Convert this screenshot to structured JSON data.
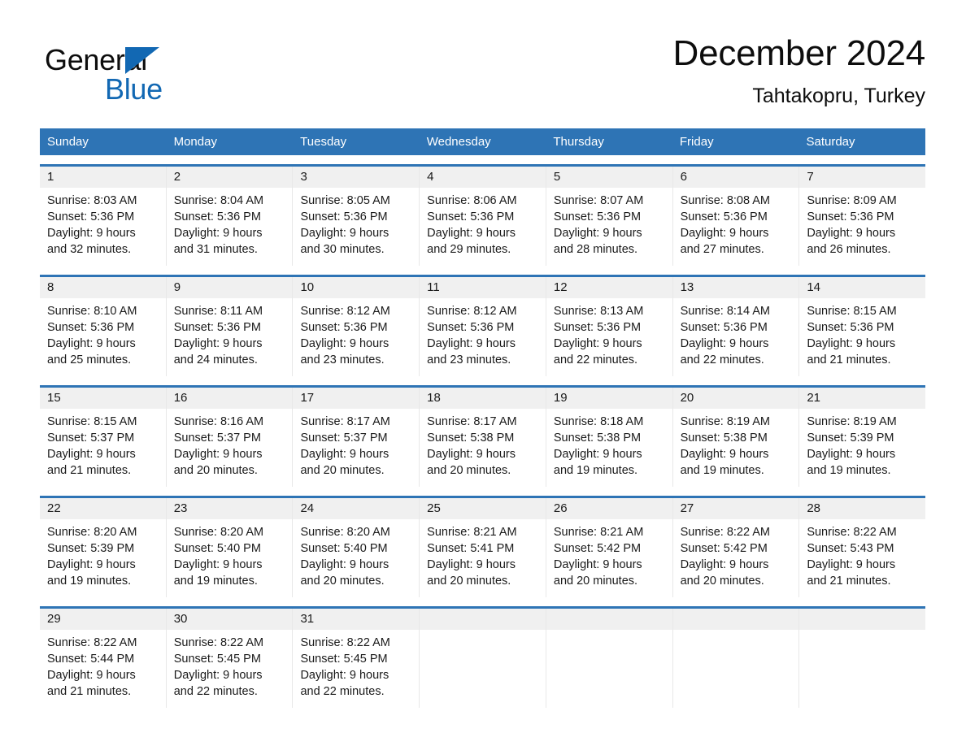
{
  "brand": {
    "name_part1": "General",
    "name_part2": "Blue",
    "accent_color": "#1268b3"
  },
  "header": {
    "title": "December 2024",
    "subtitle": "Tahtakopru, Turkey",
    "header_bg_color": "#2e74b5",
    "day_band_color": "#f0f0f0"
  },
  "weekdays": [
    "Sunday",
    "Monday",
    "Tuesday",
    "Wednesday",
    "Thursday",
    "Friday",
    "Saturday"
  ],
  "weeks": [
    [
      {
        "day": "1",
        "sunrise": "Sunrise: 8:03 AM",
        "sunset": "Sunset: 5:36 PM",
        "daylight_line1": "Daylight: 9 hours",
        "daylight_line2": "and 32 minutes."
      },
      {
        "day": "2",
        "sunrise": "Sunrise: 8:04 AM",
        "sunset": "Sunset: 5:36 PM",
        "daylight_line1": "Daylight: 9 hours",
        "daylight_line2": "and 31 minutes."
      },
      {
        "day": "3",
        "sunrise": "Sunrise: 8:05 AM",
        "sunset": "Sunset: 5:36 PM",
        "daylight_line1": "Daylight: 9 hours",
        "daylight_line2": "and 30 minutes."
      },
      {
        "day": "4",
        "sunrise": "Sunrise: 8:06 AM",
        "sunset": "Sunset: 5:36 PM",
        "daylight_line1": "Daylight: 9 hours",
        "daylight_line2": "and 29 minutes."
      },
      {
        "day": "5",
        "sunrise": "Sunrise: 8:07 AM",
        "sunset": "Sunset: 5:36 PM",
        "daylight_line1": "Daylight: 9 hours",
        "daylight_line2": "and 28 minutes."
      },
      {
        "day": "6",
        "sunrise": "Sunrise: 8:08 AM",
        "sunset": "Sunset: 5:36 PM",
        "daylight_line1": "Daylight: 9 hours",
        "daylight_line2": "and 27 minutes."
      },
      {
        "day": "7",
        "sunrise": "Sunrise: 8:09 AM",
        "sunset": "Sunset: 5:36 PM",
        "daylight_line1": "Daylight: 9 hours",
        "daylight_line2": "and 26 minutes."
      }
    ],
    [
      {
        "day": "8",
        "sunrise": "Sunrise: 8:10 AM",
        "sunset": "Sunset: 5:36 PM",
        "daylight_line1": "Daylight: 9 hours",
        "daylight_line2": "and 25 minutes."
      },
      {
        "day": "9",
        "sunrise": "Sunrise: 8:11 AM",
        "sunset": "Sunset: 5:36 PM",
        "daylight_line1": "Daylight: 9 hours",
        "daylight_line2": "and 24 minutes."
      },
      {
        "day": "10",
        "sunrise": "Sunrise: 8:12 AM",
        "sunset": "Sunset: 5:36 PM",
        "daylight_line1": "Daylight: 9 hours",
        "daylight_line2": "and 23 minutes."
      },
      {
        "day": "11",
        "sunrise": "Sunrise: 8:12 AM",
        "sunset": "Sunset: 5:36 PM",
        "daylight_line1": "Daylight: 9 hours",
        "daylight_line2": "and 23 minutes."
      },
      {
        "day": "12",
        "sunrise": "Sunrise: 8:13 AM",
        "sunset": "Sunset: 5:36 PM",
        "daylight_line1": "Daylight: 9 hours",
        "daylight_line2": "and 22 minutes."
      },
      {
        "day": "13",
        "sunrise": "Sunrise: 8:14 AM",
        "sunset": "Sunset: 5:36 PM",
        "daylight_line1": "Daylight: 9 hours",
        "daylight_line2": "and 22 minutes."
      },
      {
        "day": "14",
        "sunrise": "Sunrise: 8:15 AM",
        "sunset": "Sunset: 5:36 PM",
        "daylight_line1": "Daylight: 9 hours",
        "daylight_line2": "and 21 minutes."
      }
    ],
    [
      {
        "day": "15",
        "sunrise": "Sunrise: 8:15 AM",
        "sunset": "Sunset: 5:37 PM",
        "daylight_line1": "Daylight: 9 hours",
        "daylight_line2": "and 21 minutes."
      },
      {
        "day": "16",
        "sunrise": "Sunrise: 8:16 AM",
        "sunset": "Sunset: 5:37 PM",
        "daylight_line1": "Daylight: 9 hours",
        "daylight_line2": "and 20 minutes."
      },
      {
        "day": "17",
        "sunrise": "Sunrise: 8:17 AM",
        "sunset": "Sunset: 5:37 PM",
        "daylight_line1": "Daylight: 9 hours",
        "daylight_line2": "and 20 minutes."
      },
      {
        "day": "18",
        "sunrise": "Sunrise: 8:17 AM",
        "sunset": "Sunset: 5:38 PM",
        "daylight_line1": "Daylight: 9 hours",
        "daylight_line2": "and 20 minutes."
      },
      {
        "day": "19",
        "sunrise": "Sunrise: 8:18 AM",
        "sunset": "Sunset: 5:38 PM",
        "daylight_line1": "Daylight: 9 hours",
        "daylight_line2": "and 19 minutes."
      },
      {
        "day": "20",
        "sunrise": "Sunrise: 8:19 AM",
        "sunset": "Sunset: 5:38 PM",
        "daylight_line1": "Daylight: 9 hours",
        "daylight_line2": "and 19 minutes."
      },
      {
        "day": "21",
        "sunrise": "Sunrise: 8:19 AM",
        "sunset": "Sunset: 5:39 PM",
        "daylight_line1": "Daylight: 9 hours",
        "daylight_line2": "and 19 minutes."
      }
    ],
    [
      {
        "day": "22",
        "sunrise": "Sunrise: 8:20 AM",
        "sunset": "Sunset: 5:39 PM",
        "daylight_line1": "Daylight: 9 hours",
        "daylight_line2": "and 19 minutes."
      },
      {
        "day": "23",
        "sunrise": "Sunrise: 8:20 AM",
        "sunset": "Sunset: 5:40 PM",
        "daylight_line1": "Daylight: 9 hours",
        "daylight_line2": "and 19 minutes."
      },
      {
        "day": "24",
        "sunrise": "Sunrise: 8:20 AM",
        "sunset": "Sunset: 5:40 PM",
        "daylight_line1": "Daylight: 9 hours",
        "daylight_line2": "and 20 minutes."
      },
      {
        "day": "25",
        "sunrise": "Sunrise: 8:21 AM",
        "sunset": "Sunset: 5:41 PM",
        "daylight_line1": "Daylight: 9 hours",
        "daylight_line2": "and 20 minutes."
      },
      {
        "day": "26",
        "sunrise": "Sunrise: 8:21 AM",
        "sunset": "Sunset: 5:42 PM",
        "daylight_line1": "Daylight: 9 hours",
        "daylight_line2": "and 20 minutes."
      },
      {
        "day": "27",
        "sunrise": "Sunrise: 8:22 AM",
        "sunset": "Sunset: 5:42 PM",
        "daylight_line1": "Daylight: 9 hours",
        "daylight_line2": "and 20 minutes."
      },
      {
        "day": "28",
        "sunrise": "Sunrise: 8:22 AM",
        "sunset": "Sunset: 5:43 PM",
        "daylight_line1": "Daylight: 9 hours",
        "daylight_line2": "and 21 minutes."
      }
    ],
    [
      {
        "day": "29",
        "sunrise": "Sunrise: 8:22 AM",
        "sunset": "Sunset: 5:44 PM",
        "daylight_line1": "Daylight: 9 hours",
        "daylight_line2": "and 21 minutes."
      },
      {
        "day": "30",
        "sunrise": "Sunrise: 8:22 AM",
        "sunset": "Sunset: 5:45 PM",
        "daylight_line1": "Daylight: 9 hours",
        "daylight_line2": "and 22 minutes."
      },
      {
        "day": "31",
        "sunrise": "Sunrise: 8:22 AM",
        "sunset": "Sunset: 5:45 PM",
        "daylight_line1": "Daylight: 9 hours",
        "daylight_line2": "and 22 minutes."
      },
      {
        "day": "",
        "sunrise": "",
        "sunset": "",
        "daylight_line1": "",
        "daylight_line2": ""
      },
      {
        "day": "",
        "sunrise": "",
        "sunset": "",
        "daylight_line1": "",
        "daylight_line2": ""
      },
      {
        "day": "",
        "sunrise": "",
        "sunset": "",
        "daylight_line1": "",
        "daylight_line2": ""
      },
      {
        "day": "",
        "sunrise": "",
        "sunset": "",
        "daylight_line1": "",
        "daylight_line2": ""
      }
    ]
  ]
}
